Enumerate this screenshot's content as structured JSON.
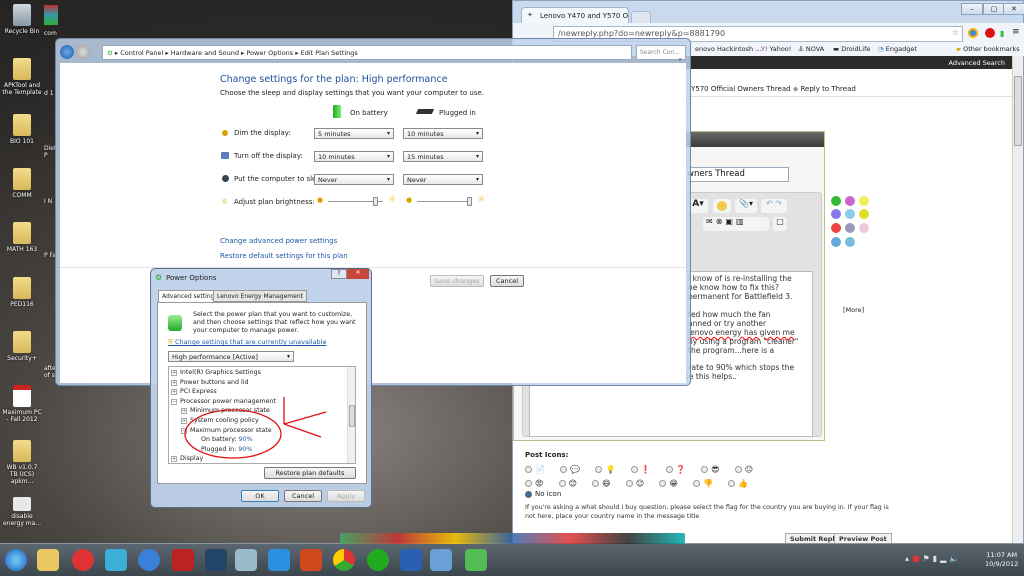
{
  "desktop": {
    "icons": [
      {
        "label": "Recycle Bin"
      },
      {
        "label": "APKTool and the Template"
      },
      {
        "label": "BIO 101"
      },
      {
        "label": "COMM"
      },
      {
        "label": "MATH 163"
      },
      {
        "label": "PED116"
      },
      {
        "label": "Security+"
      },
      {
        "label": "Maximum PC - Fall 2012"
      },
      {
        "label": "WB v1.0.7 TB (ICS) apkm..."
      },
      {
        "label": "disable energy ma..."
      }
    ],
    "partial_labels": [
      "com",
      "d 1",
      "Diet P",
      "I N",
      "P Fa",
      "afte of s"
    ]
  },
  "browser": {
    "tab_title": "Lenovo Y470 and Y570 Offi",
    "url": "/newreply.php?do=newreply&p=8881790",
    "bookmarks": [
      "enovo Hackintosh ...",
      "Yahoo!",
      "NOVA",
      "DroidLife",
      "Engadget"
    ],
    "other_bookmarks": "Other bookmarks",
    "advanced_search": "Advanced Search",
    "breadcrumb": [
      "Y570 Official Owners Thread",
      "Reply to Thread"
    ],
    "title_value": "wners Thread",
    "more": "[More]",
    "message_lines": [
      "I know of is re-installing the",
      "ne know how to fix this?",
      "permanent for Battlefield 3.",
      "",
      "ted how much the fan",
      "anned or try another",
      "lenovo energy has given me",
      "by using a program \"cleaner\"",
      "the program...here is a",
      "",
      "r rate to 90% which stops the",
      "turbo boosting heat and lag issues...I hope this helps.."
    ],
    "post_icons_label": "Post Icons:",
    "no_icon": "No icon",
    "note": "If you're asking a what should I buy question, please select the flag for the country you are buying in. If your flag is not here, place your country name in the message title",
    "submit": "Submit Reply",
    "preview": "Preview Post",
    "accent": "#2b2b2b"
  },
  "explorer": {
    "breadcrumb": [
      "Control Panel",
      "Hardware and Sound",
      "Power Options",
      "Edit Plan Settings"
    ],
    "search_placeholder": "Search Con...",
    "heading": "Change settings for the plan: High performance",
    "subheading": "Choose the sleep and display settings that you want your computer to use.",
    "col_battery": "On battery",
    "col_plugged": "Plugged in",
    "rows": [
      {
        "label": "Dim the display:",
        "battery": "5 minutes",
        "plugged": "10 minutes"
      },
      {
        "label": "Turn off the display:",
        "battery": "10 minutes",
        "plugged": "15 minutes"
      },
      {
        "label": "Put the computer to sleep:",
        "battery": "Never",
        "plugged": "Never"
      }
    ],
    "brightness_label": "Adjust plan brightness:",
    "brightness_battery_pct": 90,
    "brightness_plugged_pct": 100,
    "link_advanced": "Change advanced power settings",
    "link_restore": "Restore default settings for this plan",
    "save": "Save changes",
    "cancel": "Cancel"
  },
  "dialog": {
    "title": "Power Options",
    "tabs": [
      "Advanced settings",
      "Lenovo Energy Management"
    ],
    "intro": "Select the power plan that you want to customize, and then choose settings that reflect how you want your computer to manage power.",
    "link": "Change settings that are currently unavailable",
    "plan": "High performance [Active]",
    "tree": [
      "Intel(R) Graphics Settings",
      "Power buttons and lid",
      "PCI Express",
      "Processor power management",
      "Minimum processor state",
      "System cooling policy",
      "Maximum processor state",
      "Display"
    ],
    "on_battery_label": "On battery:",
    "on_battery": "90%",
    "plugged_label": "Plugged in:",
    "plugged": "90%",
    "restore": "Restore plan defaults",
    "ok": "OK",
    "cancel": "Cancel",
    "apply": "Apply"
  },
  "taskbar": {
    "time": "11:07 AM",
    "date": "10/9/2012"
  }
}
